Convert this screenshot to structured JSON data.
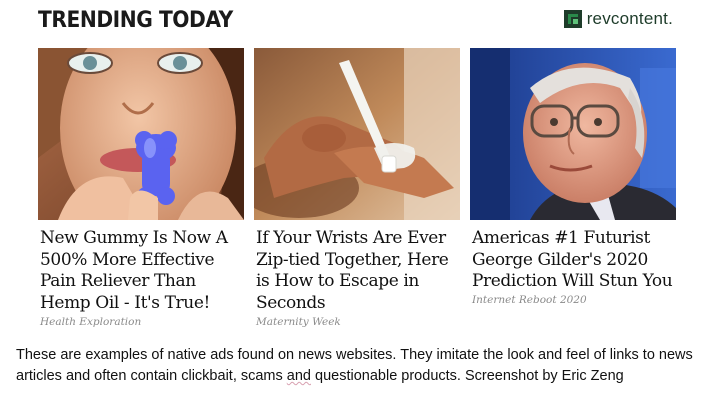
{
  "header": {
    "title": "TRENDING TODAY",
    "brand_name": "revcontent.",
    "brand_icon": "revcontent-logo-icon"
  },
  "cards": [
    {
      "headline": "New Gummy Is Now A 500% More Effective Pain Reliever Than Hemp Oil - It's True!",
      "source": "Health Exploration",
      "image": "woman-holding-blue-gummy-photo"
    },
    {
      "headline": "If Your Wrists Are Ever Zip-tied Together, Here is How to Escape in Seconds",
      "source": "Maternity Week",
      "image": "wrists-zip-tie-photo"
    },
    {
      "headline": "Americas #1 Futurist George Gilder's 2020 Prediction Will Stun You",
      "source": "Internet Reboot 2020",
      "image": "older-man-glasses-photo"
    }
  ],
  "caption": {
    "part1": "These are examples of native ads found on news websites. They imitate the look and feel of links to news articles and often contain clickbait, scams ",
    "underlined": "and",
    "part2": " questionable products. Screenshot by Eric Zeng"
  },
  "colors": {
    "brand_green": "#2a8a4a",
    "brand_dark": "#1e3c2a",
    "headline": "#111111",
    "source": "#8a8a8a"
  }
}
